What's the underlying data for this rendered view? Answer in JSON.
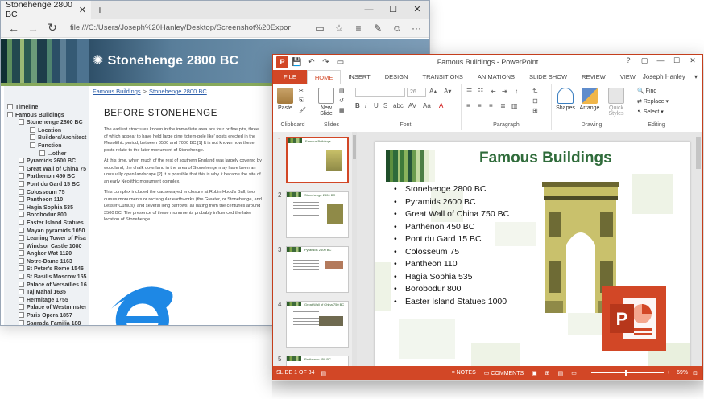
{
  "edge": {
    "tab_title": "Stonehenge 2800 BC",
    "tab_close": "✕",
    "new_tab": "+",
    "win_min": "—",
    "win_max": "☐",
    "win_close": "✕",
    "url": "file:///C:/Users/Joseph%20Hanley/Desktop/Screenshot%20Exports/MVHtmlExport/Stoneher",
    "back": "←",
    "forward": "→",
    "refresh": "↻",
    "reading": "▭",
    "favorite": "☆",
    "hub": "≡",
    "note": "✎",
    "share": "☺",
    "more": "···"
  },
  "site": {
    "header_title": "Stonehenge 2800 BC",
    "breadcrumb": [
      "Famous Buildings",
      "Stonehenge 2800 BC"
    ],
    "breadcrumb_sep": ">",
    "tree": [
      {
        "label": "Timeline",
        "level": 1
      },
      {
        "label": "Famous Buildings",
        "level": 1
      },
      {
        "label": "Stonehenge 2800 BC",
        "level": 2
      },
      {
        "label": "Location",
        "level": 3
      },
      {
        "label": "Builders/Architect",
        "level": 3
      },
      {
        "label": "Function",
        "level": 3
      },
      {
        "label": "...other",
        "level": 4
      },
      {
        "label": "Pyramids 2600 BC",
        "level": 2
      },
      {
        "label": "Great Wall of China 75",
        "level": 2
      },
      {
        "label": "Parthenon 450 BC",
        "level": 2
      },
      {
        "label": "Pont du Gard 15 BC",
        "level": 2
      },
      {
        "label": "Colosseum 75",
        "level": 2
      },
      {
        "label": "Pantheon 110",
        "level": 2
      },
      {
        "label": "Hagia Sophia 535",
        "level": 2
      },
      {
        "label": "Borobodur 800",
        "level": 2
      },
      {
        "label": "Easter Island Statues",
        "level": 2
      },
      {
        "label": "Mayan pyramids 1050",
        "level": 2
      },
      {
        "label": "Leaning Tower of Pisa",
        "level": 2
      },
      {
        "label": "Windsor Castle 1080",
        "level": 2
      },
      {
        "label": "Angkor Wat 1120",
        "level": 2
      },
      {
        "label": "Notre-Dame 1163",
        "level": 2
      },
      {
        "label": "St Peter's Rome 1546",
        "level": 2
      },
      {
        "label": "St Basil's Moscow 155",
        "level": 2
      },
      {
        "label": "Palace of Versailles 16",
        "level": 2
      },
      {
        "label": "Taj Mahal 1635",
        "level": 2
      },
      {
        "label": "Hermitage 1755",
        "level": 2
      },
      {
        "label": "Palace of Westminster",
        "level": 2
      },
      {
        "label": "Paris Opera 1857",
        "level": 2
      },
      {
        "label": "Sagrada Familia 188",
        "level": 2
      }
    ],
    "article_heading": "BEFORE STONEHENGE",
    "paragraphs": [
      "The earliest structures known in the immediate area are four or five pits, three of which appear to have held large pine 'totem-pole like' posts erected in the Mesolithic period, between 8500 and 7000 BC.[1] It is not known how these posts relate to the later monument of Stonehenge.",
      "At this time, when much of the rest of southern England was largely covered by woodland, the chalk downland in the area of Stonehenge may have been an unusually open landscape.[2] It is possible that this is why it became the site of an early Neolithic monument complex.",
      "This complex included the causewayed enclosure at Robin Hood's Ball, two cursus monuments or rectangular earthworks (the Greater, or Stonehenge, and Lesser Cursus), and several long barrows, all dating from the centuries around 3500 BC. The presence of these monuments probably influenced the later location of Stonehenge."
    ]
  },
  "ppt": {
    "window_title": "Famous Buildings - PowerPoint",
    "qat": {
      "save": "💾",
      "undo": "↶",
      "redo": "↷",
      "present": "▭"
    },
    "win": {
      "help": "?",
      "restore": "▢",
      "min": "—",
      "max": "☐",
      "close": "✕"
    },
    "tabs": [
      "FILE",
      "HOME",
      "INSERT",
      "DESIGN",
      "TRANSITIONS",
      "ANIMATIONS",
      "SLIDE SHOW",
      "REVIEW",
      "VIEW"
    ],
    "user": "Joseph Hanley",
    "ribbon": {
      "paste": "Paste",
      "new_slide": "New Slide",
      "font_size": "26",
      "shapes": "Shapes",
      "arrange": "Arrange",
      "quick_styles": "Quick Styles",
      "find": "Find",
      "replace": "Replace",
      "select": "Select",
      "groups": [
        "Clipboard",
        "Slides",
        "Font",
        "Paragraph",
        "Drawing",
        "Editing"
      ]
    },
    "thumbnails": [
      {
        "num": "1",
        "title": "Famous Buildings"
      },
      {
        "num": "2",
        "title": "Stonehenge 2800 BC"
      },
      {
        "num": "3",
        "title": "Pyramids 2600 BC"
      },
      {
        "num": "4",
        "title": "Great Wall of China 750 BC"
      },
      {
        "num": "5",
        "title": "Parthenon 450 BC"
      }
    ],
    "slide": {
      "title": "Famous Buildings",
      "bullets": [
        "Stonehenge 2800 BC",
        "Pyramids 2600 BC",
        "Great Wall of China 750 BC",
        "Parthenon 450 BC",
        "Pont du Gard 15 BC",
        "Colosseum 75",
        "Pantheon 110",
        "Hagia Sophia 535",
        "Borobodur 800",
        "Easter Island Statues 1000"
      ]
    },
    "status": {
      "slide_of": "SLIDE 1 OF 34",
      "notes": "NOTES",
      "comments": "COMMENTS",
      "zoom": "69%",
      "zoom_minus": "−",
      "zoom_plus": "+"
    },
    "accent": "#d24726"
  }
}
